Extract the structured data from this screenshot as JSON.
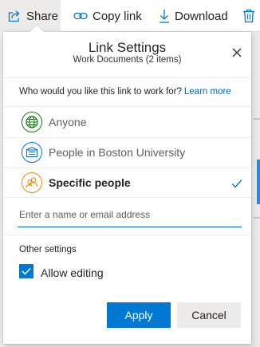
{
  "commandbar": {
    "share_label": "Share",
    "copy_link_label": "Copy link",
    "download_label": "Download"
  },
  "dialog": {
    "title": "Link Settings",
    "subtitle": "Work Documents (2 items)",
    "question": "Who would you like this link to work for?",
    "learn_more": "Learn more",
    "options": [
      {
        "label": "Anyone",
        "icon": "globe-icon",
        "color": "#107c10",
        "selected": false
      },
      {
        "label": "People in Boston University",
        "icon": "building-icon",
        "color": "#0078d4",
        "selected": false
      },
      {
        "label": "Specific people",
        "icon": "people-icon",
        "color": "#ea8b00",
        "selected": true
      }
    ],
    "recipient_placeholder": "Enter a name or email address",
    "recipient_value": "",
    "other_settings_label": "Other settings",
    "allow_editing_label": "Allow editing",
    "allow_editing_checked": true,
    "apply_label": "Apply",
    "cancel_label": "Cancel"
  },
  "colors": {
    "accent": "#0078d4",
    "link": "#0067b8"
  }
}
